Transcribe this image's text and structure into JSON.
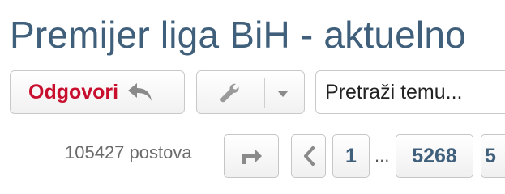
{
  "header": {
    "title": "Premijer liga BiH - aktuelno"
  },
  "toolbar": {
    "reply_label": "Odgovori",
    "reply_icon": "reply-arrow-icon",
    "tools_icon": "wrench-icon",
    "dropdown_icon": "caret-down-icon",
    "search_placeholder": "Pretraži temu..."
  },
  "pagination": {
    "post_count": "105427 postova",
    "jump_icon": "jump-to-page-icon",
    "prev_icon": "chevron-left-icon",
    "pages": [
      "1",
      "5268",
      "5"
    ],
    "ellipsis": "..."
  },
  "colors": {
    "title": "#3f5f7b",
    "accent_red": "#c8102e",
    "page_link": "#3f5f7b"
  }
}
